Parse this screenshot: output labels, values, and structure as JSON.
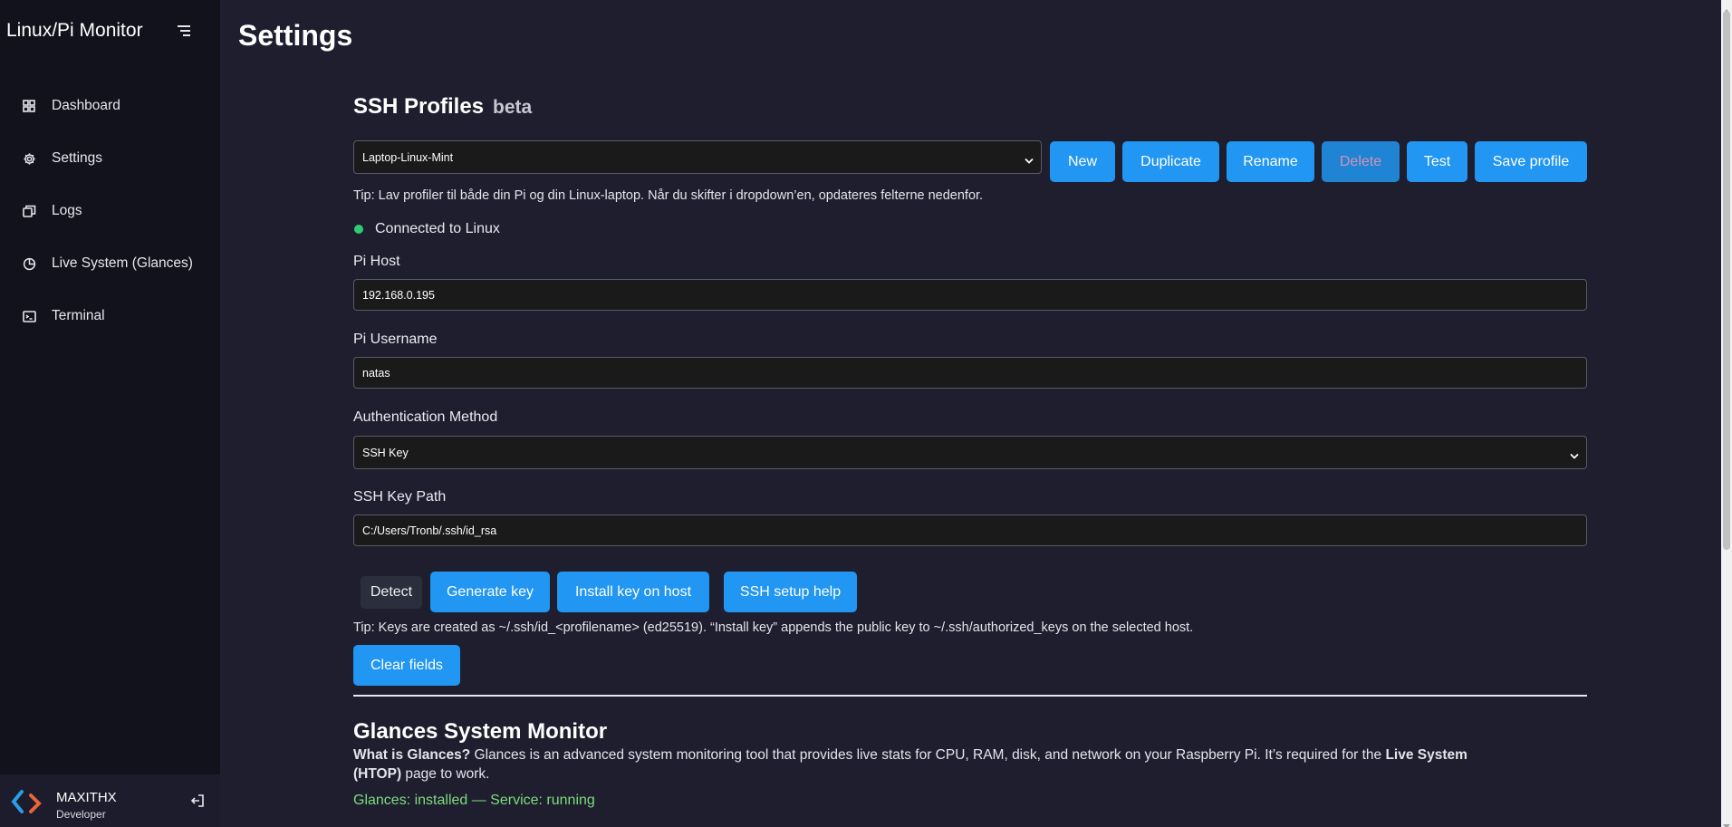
{
  "sidebar": {
    "brand": "Linux/Pi Monitor",
    "items": [
      {
        "label": "Dashboard",
        "icon": "grid-icon"
      },
      {
        "label": "Settings",
        "icon": "gear-icon"
      },
      {
        "label": "Logs",
        "icon": "logs-icon"
      },
      {
        "label": "Live System (Glances)",
        "icon": "pie-chart-icon"
      },
      {
        "label": "Terminal",
        "icon": "terminal-icon"
      }
    ],
    "user": {
      "name": "MAXITHX",
      "role": "Developer"
    }
  },
  "page": {
    "title": "Settings"
  },
  "ssh": {
    "heading": "SSH Profiles",
    "badge": "beta",
    "profile_selected": "Laptop-Linux-Mint",
    "buttons": {
      "new": "New",
      "duplicate": "Duplicate",
      "rename": "Rename",
      "delete": "Delete",
      "test": "Test",
      "save": "Save profile"
    },
    "tip_profiles": "Tip: Lav profiler til både din Pi og din Linux-laptop. Når du skifter i dropdown’en, opdateres felterne nedenfor.",
    "status": "Connected to Linux",
    "host_label": "Pi Host",
    "host_value": "192.168.0.195",
    "username_label": "Pi Username",
    "username_value": "natas",
    "auth_label": "Authentication Method",
    "auth_value": "SSH Key",
    "keypath_label": "SSH Key Path",
    "keypath_value": "C:/Users/Tronb/.ssh/id_rsa",
    "key_buttons": {
      "detect": "Detect",
      "generate": "Generate key",
      "install": "Install key on host",
      "help": "SSH setup help"
    },
    "tip_keys": "Tip: Keys are created as ~/.ssh/id_<profilename> (ed25519). “Install key” appends the public key to ~/.ssh/authorized_keys on the selected host.",
    "clear": "Clear fields"
  },
  "glances": {
    "heading": "Glances System Monitor",
    "what_is": "What is Glances?",
    "desc_1": " Glances is an advanced system monitoring tool that provides live stats for CPU, RAM, disk, and network on your Raspberry Pi. It’s required for the ",
    "desc_bold": "Live System (HTOP)",
    "desc_2": " page to work.",
    "status": "Glances: installed — Service: running"
  },
  "colors": {
    "accent": "#2196f3",
    "status_ok": "#2ecc71",
    "glances_status": "#7ddc7d"
  }
}
